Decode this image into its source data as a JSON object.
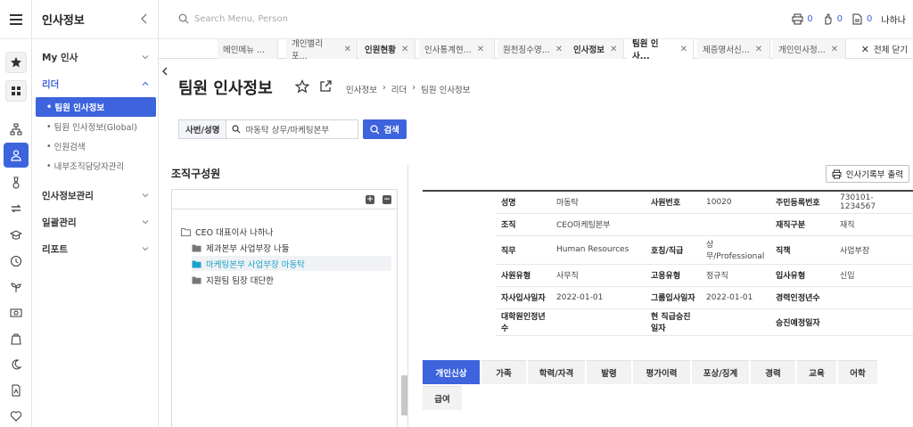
{
  "app": {
    "title": "인사정보",
    "search_placeholder": "Search Menu, Person"
  },
  "topbar": {
    "print_count": "0",
    "approve_count": "0",
    "doc_count": "0",
    "user": "나하나"
  },
  "sidebar": {
    "groups": [
      {
        "label": "My 인사"
      },
      {
        "label": "리더",
        "items": [
          "팀원 인사정보",
          "팀원 인사정보(Global)",
          "인원검색",
          "내부조직담당자관리"
        ]
      },
      {
        "label": "인사정보관리"
      },
      {
        "label": "일괄관리"
      },
      {
        "label": "리포트"
      }
    ]
  },
  "tabs": [
    {
      "label": "메인메뉴 ...",
      "close": false
    },
    {
      "label": "개인별리포...",
      "close": true
    },
    {
      "label": "인원현황",
      "close": true
    },
    {
      "label": "인사통계현...",
      "close": true
    },
    {
      "label": "원천징수영...",
      "close": true
    },
    {
      "label": "인사정보",
      "close": true
    },
    {
      "label": "팀원 인사...",
      "close": true
    },
    {
      "label": "제증명서신...",
      "close": true
    },
    {
      "label": "개인인사정...",
      "close": true
    }
  ],
  "close_all": "전체 닫기",
  "page": {
    "title": "팀원 인사정보",
    "breadcrumb": [
      "인사정보",
      "리더",
      "팀원 인사정보"
    ],
    "filter_label": "사번/성명",
    "filter_value": "마동탁 상무/마케팅본부",
    "search_button": "검색",
    "org_title": "조직구성원",
    "print_button": "인사기록부 출력"
  },
  "tree": {
    "root": "CEO 대표이사 나하나",
    "children": [
      "제과본부 사업부장 나둘",
      "마케팅본부 사업부장 마동탁",
      "지원팀 팀장 대단한"
    ]
  },
  "info": {
    "name_label": "성명",
    "name": "마동탁",
    "empno_label": "사원번호",
    "empno": "10020",
    "rrn_label": "주민등록번호",
    "rrn": "730101-1234567",
    "org_label": "조직",
    "org": "CEO마케팅본부",
    "status_label": "재직구분",
    "status": "재직",
    "duty_label": "직무",
    "duty": "Human Resources",
    "title_label": "호칭/직급",
    "title": "상무/Professional",
    "position_label": "직책",
    "position": "사업부장",
    "emptype_label": "사원유형",
    "emptype": "사무직",
    "hiretype_label": "고용유형",
    "hiretype": "정규직",
    "entrytype_label": "입사유형",
    "entrytype": "신입",
    "cojoin_label": "자사입사일자",
    "cojoin": "2022-01-01",
    "groupjoin_label": "그룹입사일자",
    "groupjoin": "2022-01-01",
    "career_label": "경력인정년수",
    "career": "",
    "grad_label": "대학원인정년수",
    "grad": "",
    "promo_label": "현 직급승진일자",
    "promo": "",
    "nextpromo_label": "승진예정일자",
    "nextpromo": ""
  },
  "bottom_tabs": [
    "개인신상",
    "가족",
    "학력/자격",
    "발령",
    "평가이력",
    "포상/징계",
    "경력",
    "교육",
    "어학",
    "급여"
  ]
}
